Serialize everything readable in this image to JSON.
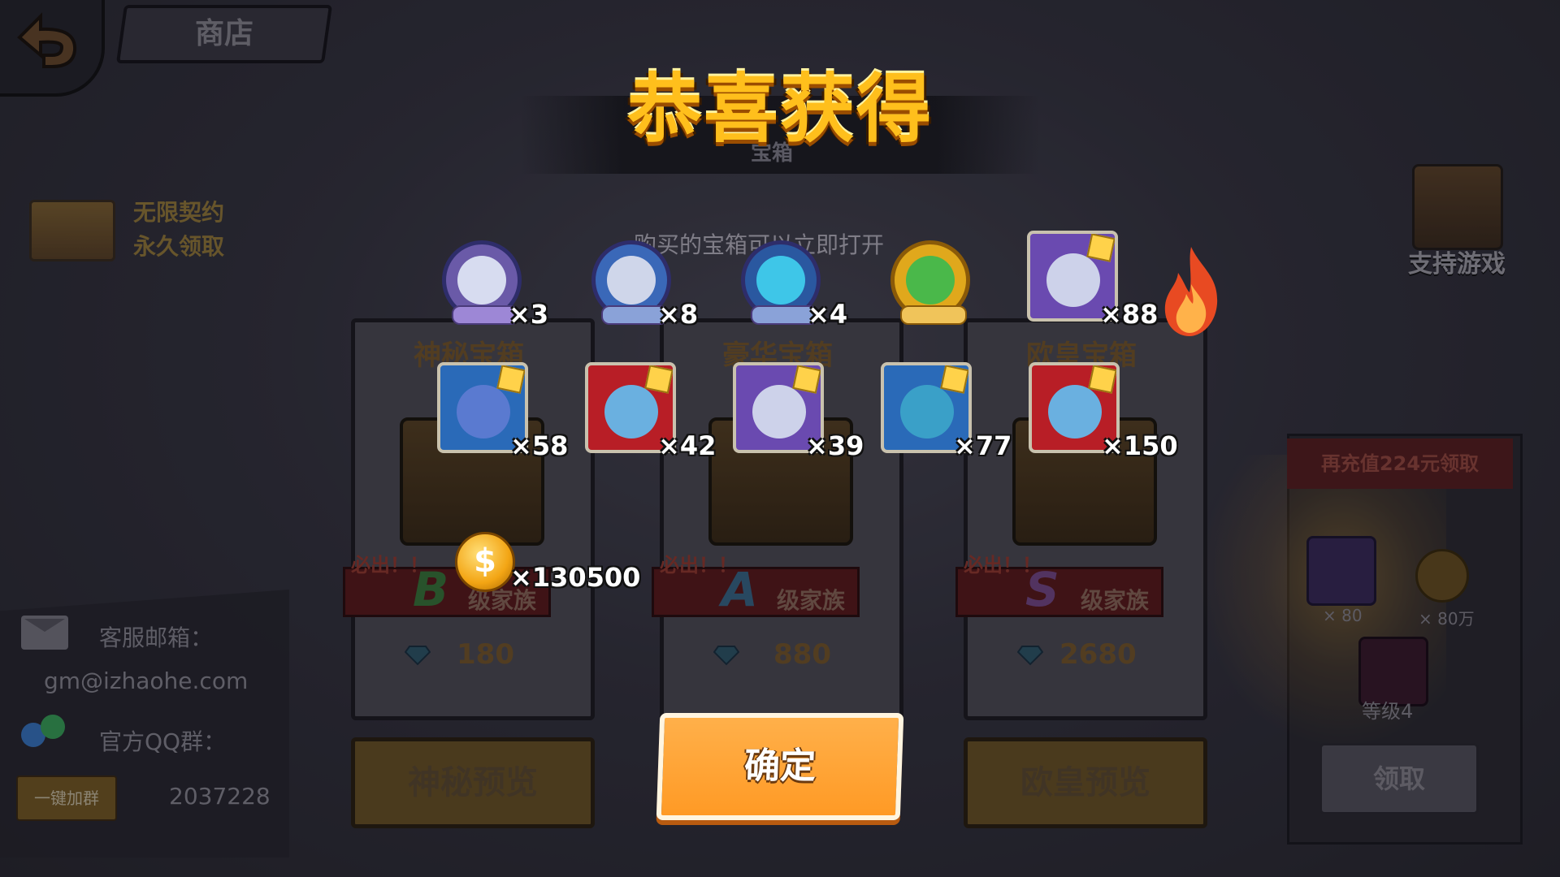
{
  "shop": {
    "back_icon": "back-arrow-icon",
    "title": "商店",
    "contract": {
      "line1": "无限契约",
      "line2": "永久领取"
    },
    "support_label": "支持游戏",
    "contact": {
      "email_label": "客服邮箱：",
      "email": "gm@izhaohe.com",
      "qq_label": "官方QQ群：",
      "join_button": "一键加群",
      "qq_number": "2037228"
    },
    "recharge": {
      "title": "再充值224元领取",
      "items": [
        {
          "icon": "skull-dragon-card-icon",
          "count": "× 80"
        },
        {
          "icon": "gold-coin-icon",
          "count": "× 80万"
        },
        {
          "icon": "dark-warrior-card-icon",
          "count": "等级4"
        }
      ],
      "claim_button": "领取"
    },
    "chests": [
      {
        "name": "神秘宝箱",
        "must": "必出！！",
        "grade": "B",
        "grade_color": "#3a8a3a",
        "family": "级家族",
        "price": "180",
        "preview": "神秘预览"
      },
      {
        "name": "豪华宝箱",
        "must": "必出！！",
        "grade": "A",
        "grade_color": "#3a6a8a",
        "family": "级家族",
        "price": "880",
        "preview": ""
      },
      {
        "name": "欧皇宝箱",
        "must": "必出！！",
        "grade": "S",
        "grade_color": "#7a4a8a",
        "family": "级家族",
        "price": "2680",
        "preview": "欧皇预览"
      }
    ],
    "subtitle_fragment": "宝箱",
    "hint": "购买的宝箱可以立即打开"
  },
  "popup": {
    "title": "恭喜获得",
    "rewards_row1": [
      {
        "icon": "purple-yeti-token-icon",
        "count": "×3"
      },
      {
        "icon": "blue-yeti-token-icon",
        "count": "×8"
      },
      {
        "icon": "blue-fish-token-icon",
        "count": "×4"
      },
      {
        "icon": "gold-cactus-token-icon",
        "count": ""
      },
      {
        "icon": "purple-yeti-card-icon",
        "count": "×88"
      }
    ],
    "rewards_row2": [
      {
        "icon": "blue-robot-card-icon",
        "count": "×58"
      },
      {
        "icon": "red-bunny-girl-card-icon",
        "count": "×42"
      },
      {
        "icon": "purple-yeti-card-icon",
        "count": "×39"
      },
      {
        "icon": "blue-seahorse-card-icon",
        "count": "×77"
      },
      {
        "icon": "red-bunny-girl-card-icon",
        "count": "×150"
      }
    ],
    "coin_reward": {
      "icon": "gold-coin-icon",
      "symbol": "$",
      "count": "×130500"
    },
    "confirm_button": "确定",
    "flame_icon": "flame-icon"
  },
  "colors": {
    "title_gold": "#ffbf1c",
    "confirm_orange": "#ff9a25",
    "background": "#2e2d36"
  }
}
